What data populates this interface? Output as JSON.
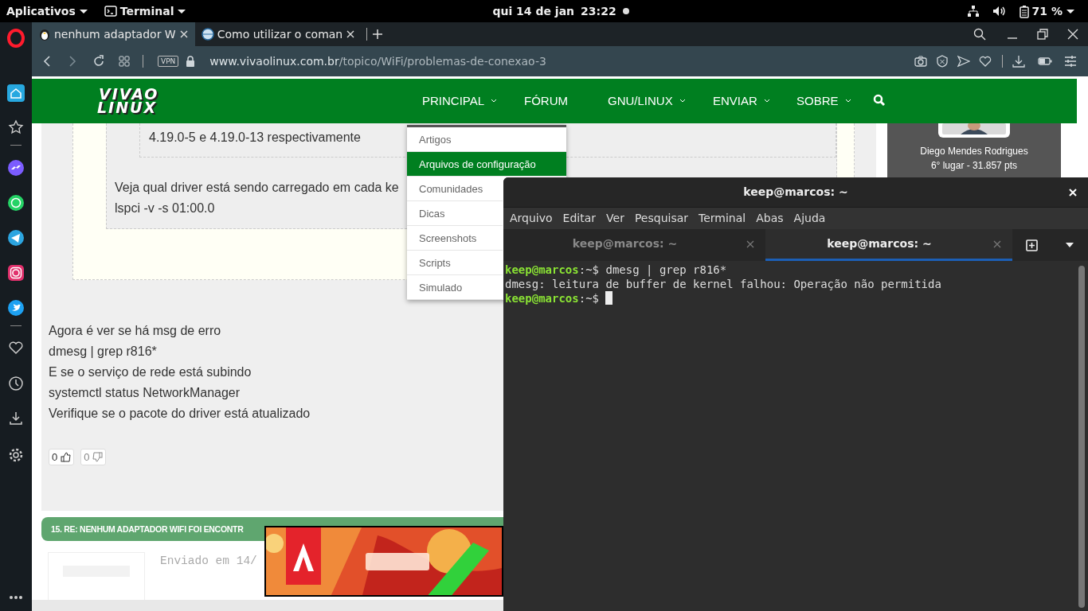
{
  "top_bar": {
    "menus": [
      {
        "label": "Aplicativos",
        "kind": "apps"
      },
      {
        "label": "Terminal",
        "kind": "app"
      }
    ],
    "date": "qui 14 de jan",
    "time": "23:22",
    "battery": "71 %"
  },
  "browser": {
    "tabs": [
      {
        "title": "nenhum adaptador W",
        "selected": true,
        "kind": "penguin"
      },
      {
        "title": "Como utilizar o coman",
        "selected": false,
        "kind": "globe"
      }
    ],
    "vpn": "VPN",
    "url_domain": "www.vivaolinux.com.br",
    "url_path": "/topico/WiFi/problemas-de-conexao-3"
  },
  "site": {
    "logo": [
      "VIVAO",
      "LINUX"
    ],
    "nav": [
      {
        "label": "PRINCIPAL",
        "dropdown": true
      },
      {
        "label": "FÓRUM",
        "dropdown": false
      },
      {
        "label": "GNU/LINUX",
        "dropdown": true
      },
      {
        "label": "ENVIAR",
        "dropdown": true
      },
      {
        "label": "SOBRE",
        "dropdown": true
      }
    ],
    "menu": [
      {
        "label": "Artigos",
        "selected": false
      },
      {
        "label": "Arquivos de configuração",
        "selected": true
      },
      {
        "label": "Comunidades",
        "selected": false
      },
      {
        "label": "Dicas",
        "selected": false
      },
      {
        "label": "Screenshots",
        "selected": false
      },
      {
        "label": "Scripts",
        "selected": false
      },
      {
        "label": "Simulado",
        "selected": false
      }
    ],
    "quote_inner": "4.19.0-5 e 4.19.0-13 respectivamente",
    "quote_lines": [
      "Veja qual driver está sendo carregado em cada ke",
      "lspci -v -s 01:00.0"
    ],
    "post_lines": [
      "Agora é ver se há msg de erro",
      "dmesg | grep r816*",
      "E se o serviço de rede está subindo",
      "systemctl status NetworkManager",
      "Verifique se o pacote do driver está atualizado"
    ],
    "votes": [
      {
        "count": "0",
        "kind": "up"
      },
      {
        "count": "0",
        "kind": "down"
      }
    ],
    "next_post_title": "15. RE: NENHUM ADAPTADOR WIFI FOI ENCONTR",
    "sent": "Enviado em 14/",
    "ranking": {
      "name": "Diego Mendes Rodrigues",
      "rank": "6° lugar - 31.857 pts"
    }
  },
  "terminal": {
    "title": "keep@marcos: ~",
    "menu": [
      "Arquivo",
      "Editar",
      "Ver",
      "Pesquisar",
      "Terminal",
      "Abas",
      "Ajuda"
    ],
    "tabs": [
      {
        "title": "keep@marcos: ~",
        "selected": false
      },
      {
        "title": "keep@marcos: ~",
        "selected": true
      }
    ],
    "lines": [
      {
        "kind": "prompt",
        "user": "keep@marcos",
        "path": ":~$",
        "command": "dmesg | grep r816*"
      },
      {
        "kind": "output",
        "text": "dmesg: leitura de buffer de kernel falhou: Operação não permitida"
      },
      {
        "kind": "prompt",
        "user": "keep@marcos",
        "path": ":~$",
        "cursor": true
      }
    ]
  }
}
